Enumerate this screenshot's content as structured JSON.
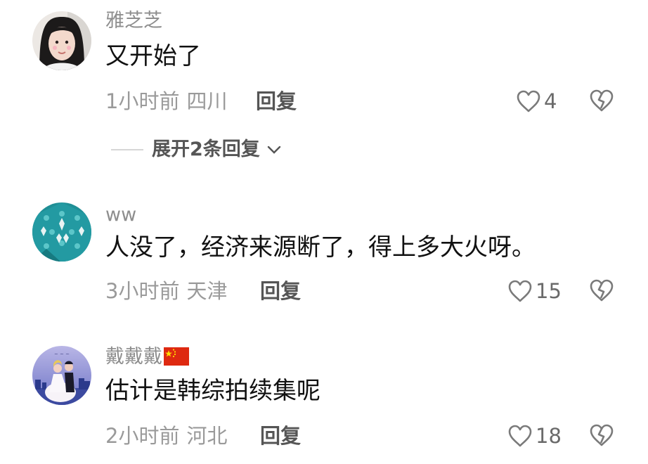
{
  "comments": [
    {
      "username": "雅芝芝",
      "text": "又开始了",
      "time": "1小时前",
      "location": "四川",
      "reply_label": "回复",
      "likes": "4",
      "expand_label": "展开2条回复"
    },
    {
      "username": "ww",
      "text": "人没了，经济来源断了，得上多大火呀。",
      "time": "3小时前",
      "location": "天津",
      "reply_label": "回复",
      "likes": "15"
    },
    {
      "username": "戴戴戴",
      "text": "估计是韩综拍续集呢",
      "time": "2小时前",
      "location": "河北",
      "reply_label": "回复",
      "likes": "18"
    }
  ],
  "icons": {
    "like": "heart-outline-icon",
    "dislike": "broken-heart-icon",
    "expand": "chevron-down-icon",
    "flag": "china-flag-icon"
  },
  "colors": {
    "username": "#8e8e8e",
    "meta": "#9a9a9a",
    "flag_red": "#de2910",
    "flag_star": "#ffde00"
  }
}
